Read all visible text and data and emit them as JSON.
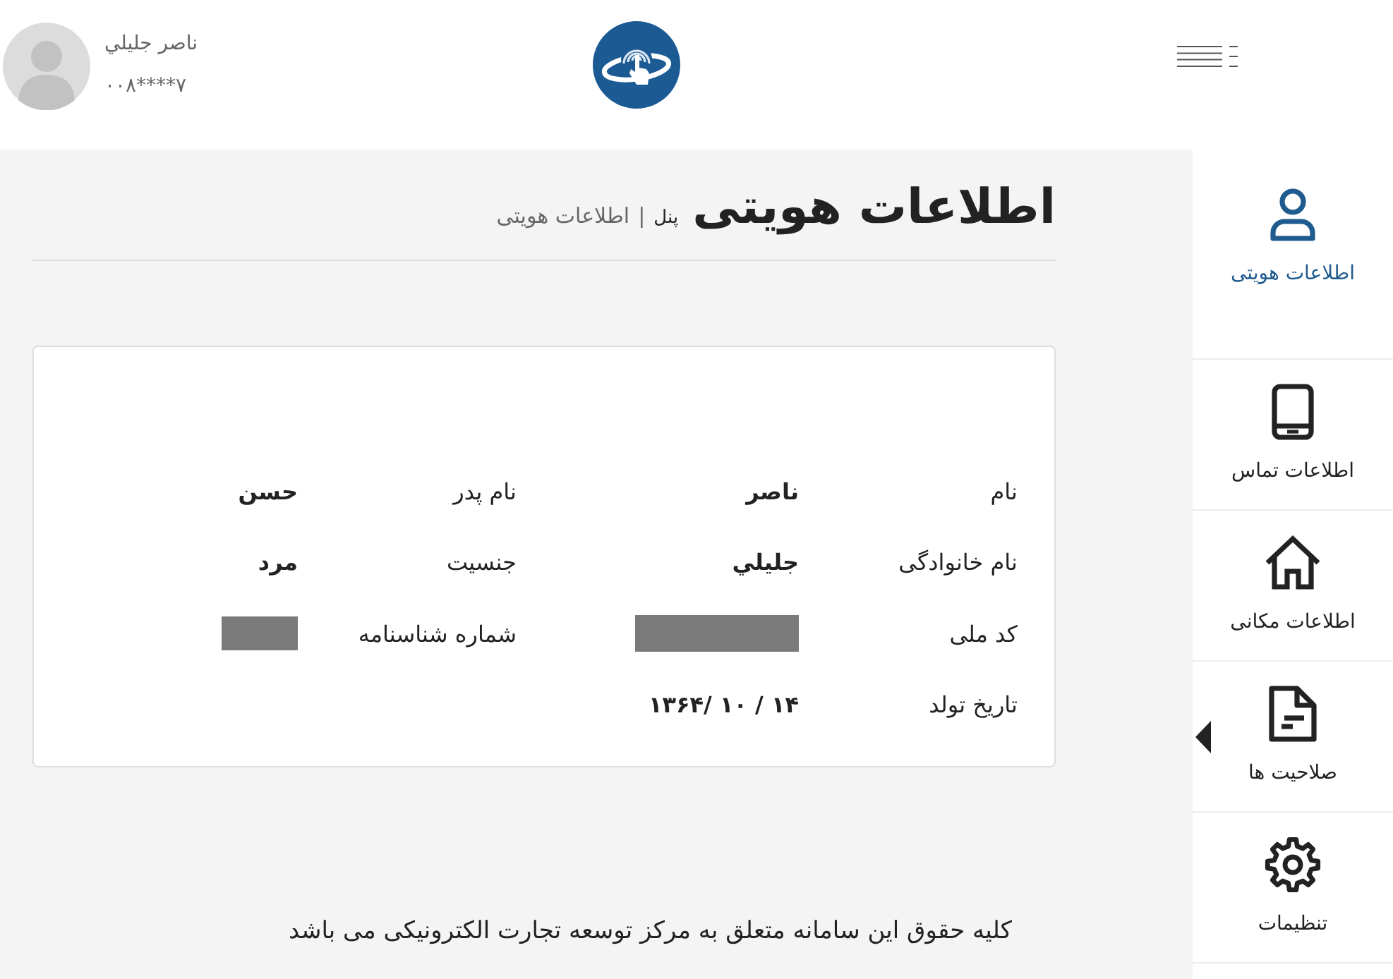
{
  "header": {
    "user": {
      "name": "ناصر جليلي",
      "phone": "۰۰۸****۷"
    }
  },
  "sidebar": {
    "items": [
      {
        "label": "اطلاعات هویتی",
        "selected": true,
        "pointer": false
      },
      {
        "label": "اطلاعات تماس",
        "selected": false,
        "pointer": false
      },
      {
        "label": "اطلاعات مکانی",
        "selected": false,
        "pointer": false
      },
      {
        "label": "صلاحیت ها",
        "selected": false,
        "pointer": true
      },
      {
        "label": "تنظیمات",
        "selected": false,
        "pointer": false
      }
    ]
  },
  "page": {
    "title": "اطلاعات هویتی",
    "breadcrumb": {
      "items": [
        "پنل",
        "اطلاعات هویتی"
      ],
      "separator": "|"
    }
  },
  "identity_card": {
    "fields": [
      {
        "label": "نام",
        "value": "ناصر",
        "redacted": false
      },
      {
        "label": "نام پدر",
        "value": "حسن",
        "redacted": false
      },
      {
        "label": "نام خانوادگی",
        "value": "جليلي",
        "redacted": false
      },
      {
        "label": "جنسیت",
        "value": "مرد",
        "redacted": false
      },
      {
        "label": "کد ملی",
        "redacted": true
      },
      {
        "label": "شماره شناسنامه",
        "redacted": true
      },
      {
        "label": "تاریخ تولد",
        "value": "۱۴ / ۱۰ /۱۳۶۴",
        "redacted": false
      }
    ]
  },
  "footer": {
    "text": "کلیه حقوق این سامانه متعلق به مرکز توسعه تجارت الکترونیکی می باشد"
  }
}
